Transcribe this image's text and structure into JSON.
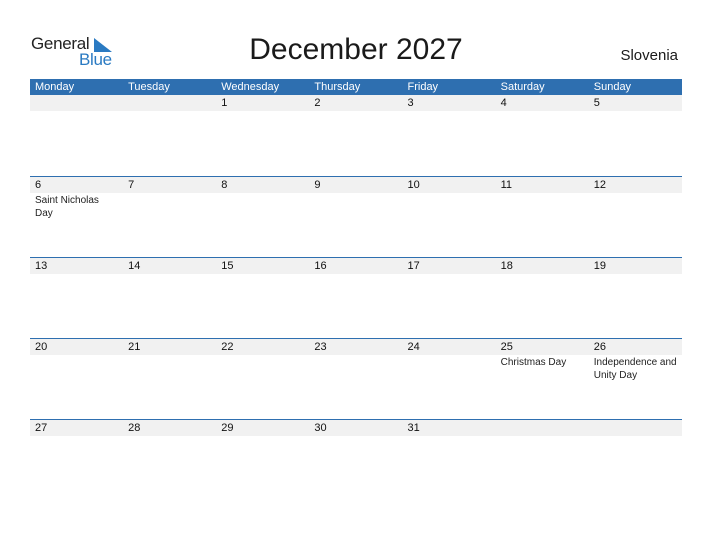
{
  "logo": {
    "general": "General",
    "blue": "Blue",
    "accent": "#2a7ac2"
  },
  "title": "December 2027",
  "country": "Slovenia",
  "colors": {
    "header_bg": "#2e6fb0",
    "date_row_bg": "#f1f1f1"
  },
  "weekdays": [
    "Monday",
    "Tuesday",
    "Wednesday",
    "Thursday",
    "Friday",
    "Saturday",
    "Sunday"
  ],
  "weeks": [
    {
      "days": [
        "",
        "",
        "1",
        "2",
        "3",
        "4",
        "5"
      ],
      "events": [
        "",
        "",
        "",
        "",
        "",
        "",
        ""
      ]
    },
    {
      "days": [
        "6",
        "7",
        "8",
        "9",
        "10",
        "11",
        "12"
      ],
      "events": [
        "Saint Nicholas Day",
        "",
        "",
        "",
        "",
        "",
        ""
      ]
    },
    {
      "days": [
        "13",
        "14",
        "15",
        "16",
        "17",
        "18",
        "19"
      ],
      "events": [
        "",
        "",
        "",
        "",
        "",
        "",
        ""
      ]
    },
    {
      "days": [
        "20",
        "21",
        "22",
        "23",
        "24",
        "25",
        "26"
      ],
      "events": [
        "",
        "",
        "",
        "",
        "",
        "Christmas Day",
        "Independence and Unity Day"
      ]
    },
    {
      "days": [
        "27",
        "28",
        "29",
        "30",
        "31",
        "",
        ""
      ],
      "events": [
        "",
        "",
        "",
        "",
        "",
        "",
        ""
      ]
    }
  ]
}
